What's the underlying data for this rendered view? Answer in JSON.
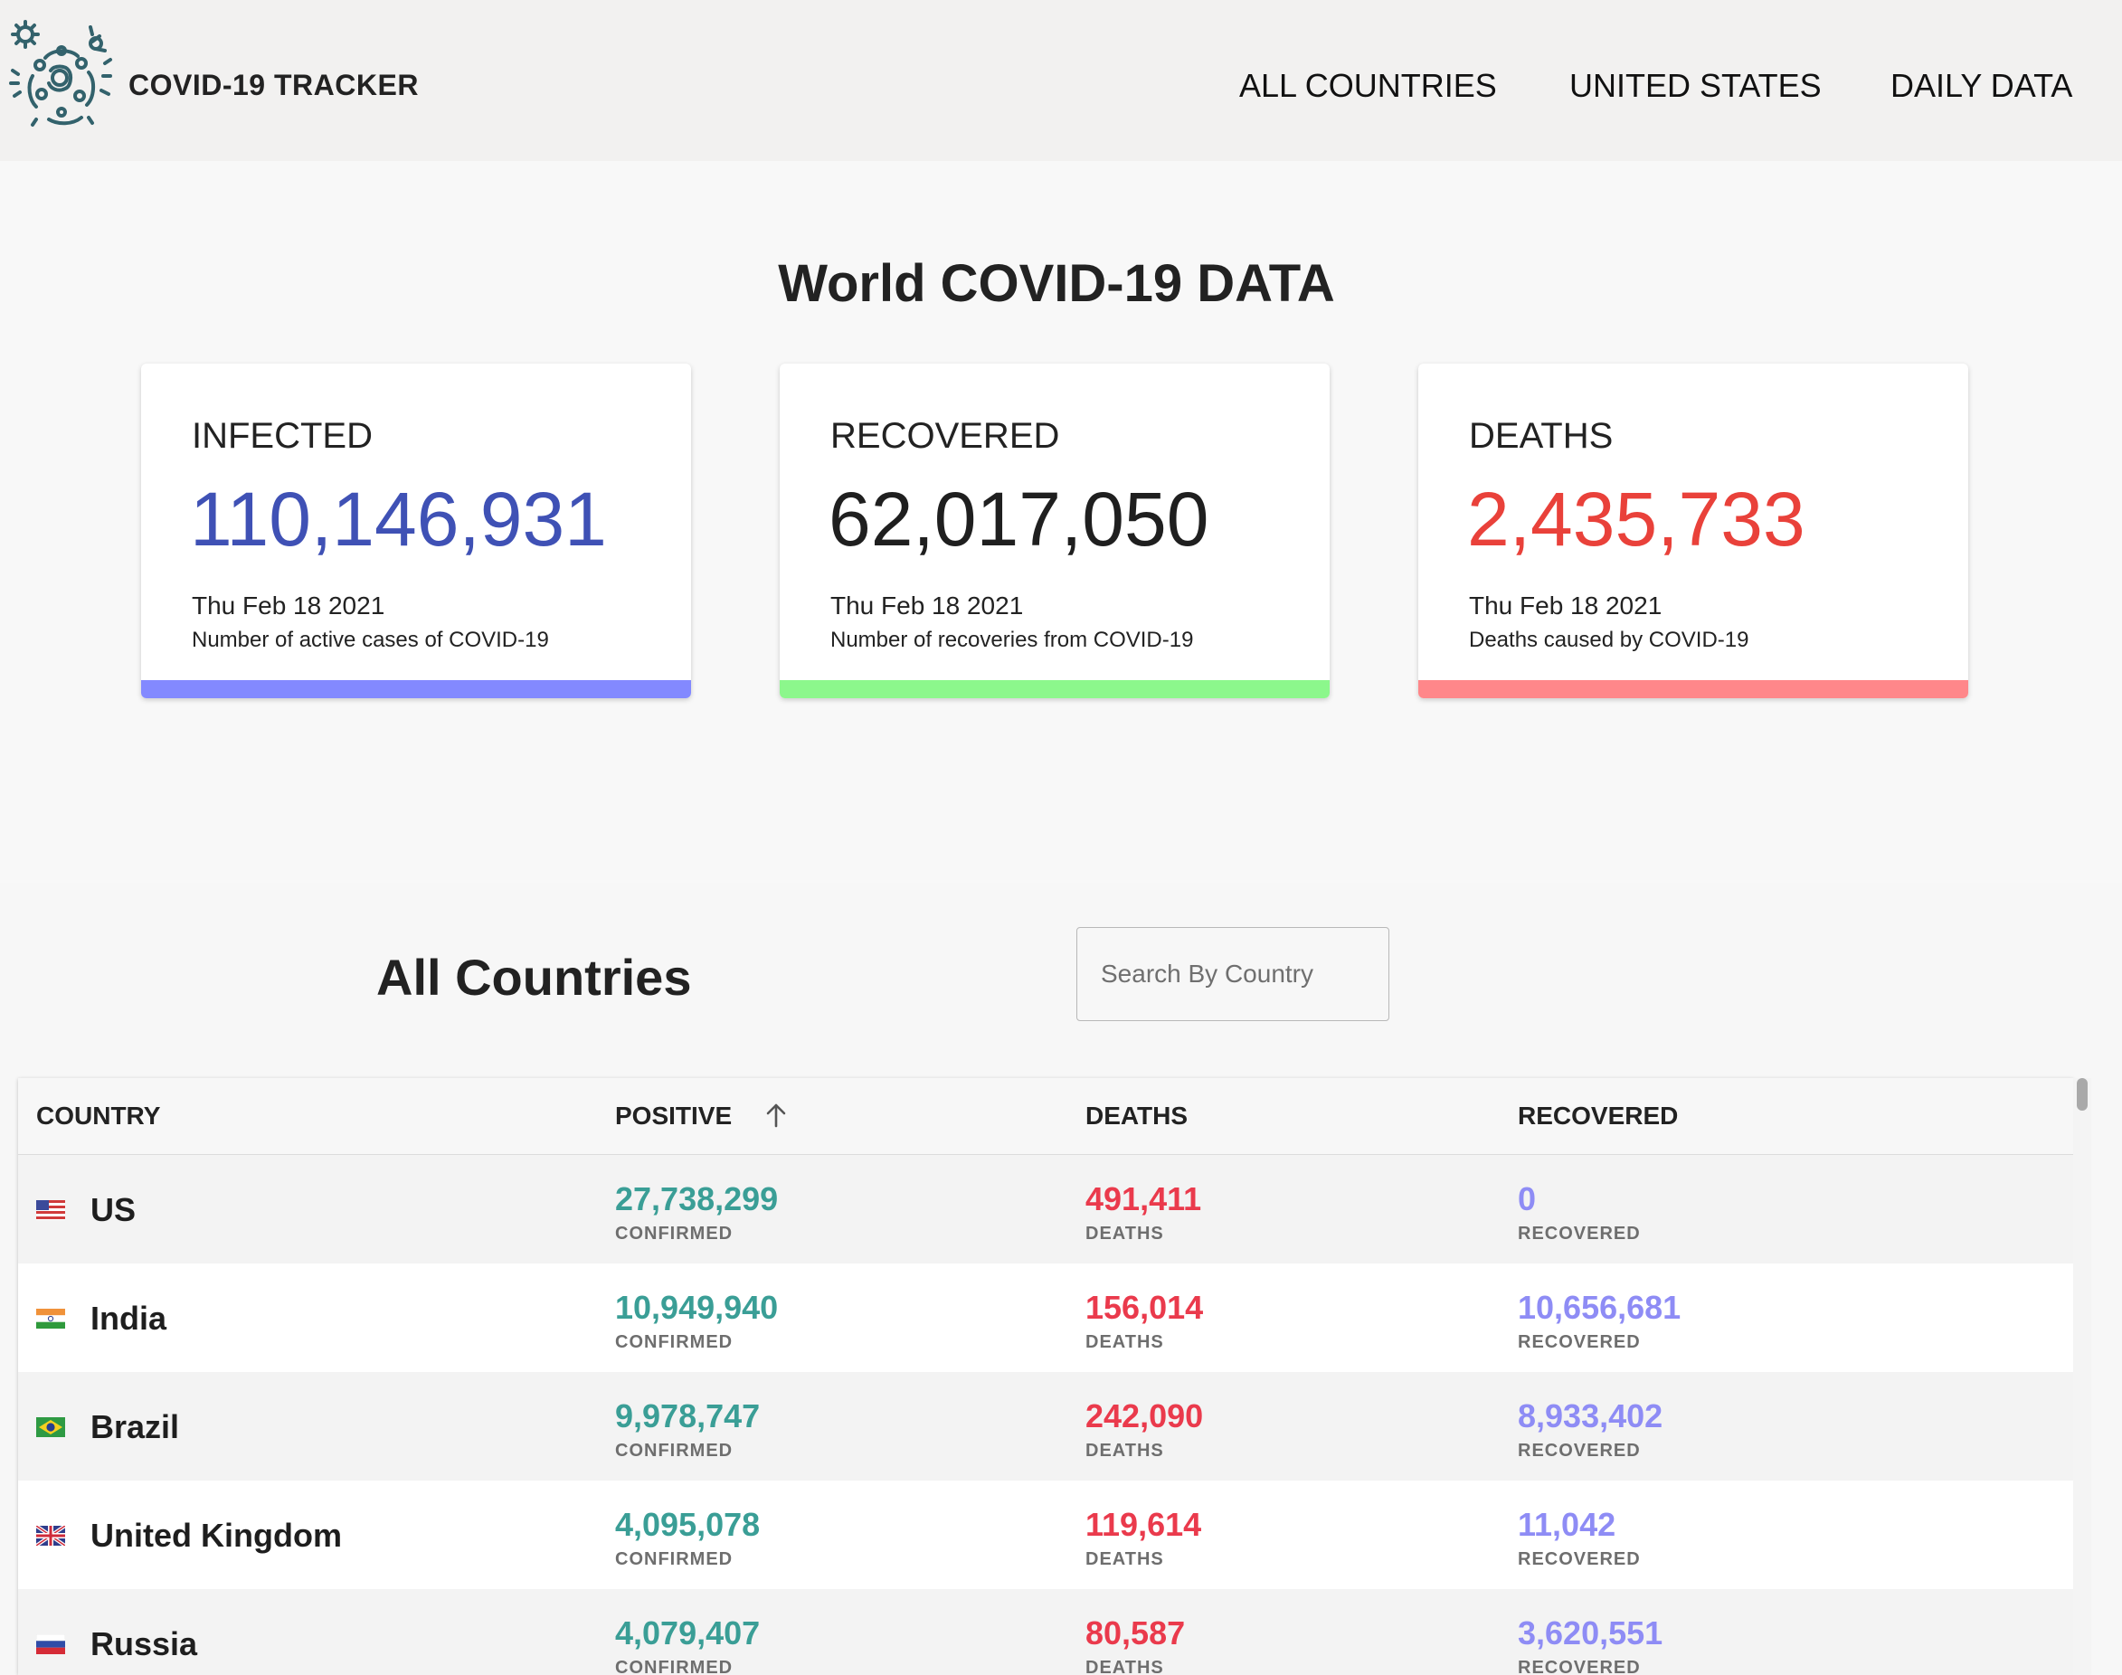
{
  "header": {
    "brand": "COVID-19 TRACKER",
    "nav": [
      "ALL COUNTRIES",
      "UNITED STATES",
      "DAILY DATA"
    ]
  },
  "world": {
    "title": "World COVID-19 DATA",
    "cards": [
      {
        "label": "INFECTED",
        "value": "110,146,931",
        "date": "Thu Feb 18 2021",
        "description": "Number of active cases of COVID-19",
        "value_color": "#3f51b5",
        "bar_color": "#8389ff"
      },
      {
        "label": "RECOVERED",
        "value": "62,017,050",
        "date": "Thu Feb 18 2021",
        "description": "Number of recoveries from COVID-19",
        "value_color": "#1f1f1f",
        "bar_color": "#8cf78c"
      },
      {
        "label": "DEATHS",
        "value": "2,435,733",
        "date": "Thu Feb 18 2021",
        "description": "Deaths caused by COVID-19",
        "value_color": "#e9413a",
        "bar_color": "#ff878a"
      }
    ]
  },
  "countries_section": {
    "title": "All Countries",
    "search_placeholder": "Search By Country"
  },
  "table": {
    "columns": [
      "COUNTRY",
      "POSITIVE",
      "DEATHS",
      "RECOVERED"
    ],
    "sort_icon": "arrow-up-icon",
    "colors": {
      "positive": "#3a9e96",
      "deaths": "#ea3a4c",
      "recovered": "#8e8cf5"
    },
    "rows": [
      {
        "country": "US",
        "flag": "us-flag-icon",
        "positive": "27,738,299",
        "positive_label": "CONFIRMED",
        "deaths": "491,411",
        "deaths_label": "DEATHS",
        "recovered": "0",
        "recovered_label": "RECOVERED"
      },
      {
        "country": "India",
        "flag": "india-flag-icon",
        "positive": "10,949,940",
        "positive_label": "CONFIRMED",
        "deaths": "156,014",
        "deaths_label": "DEATHS",
        "recovered": "10,656,681",
        "recovered_label": "RECOVERED"
      },
      {
        "country": "Brazil",
        "flag": "brazil-flag-icon",
        "positive": "9,978,747",
        "positive_label": "CONFIRMED",
        "deaths": "242,090",
        "deaths_label": "DEATHS",
        "recovered": "8,933,402",
        "recovered_label": "RECOVERED"
      },
      {
        "country": "United Kingdom",
        "flag": "uk-flag-icon",
        "positive": "4,095,078",
        "positive_label": "CONFIRMED",
        "deaths": "119,614",
        "deaths_label": "DEATHS",
        "recovered": "11,042",
        "recovered_label": "RECOVERED"
      },
      {
        "country": "Russia",
        "flag": "russia-flag-icon",
        "positive": "4,079,407",
        "positive_label": "CONFIRMED",
        "deaths": "80,587",
        "deaths_label": "DEATHS",
        "recovered": "3,620,551",
        "recovered_label": "RECOVERED"
      }
    ]
  }
}
